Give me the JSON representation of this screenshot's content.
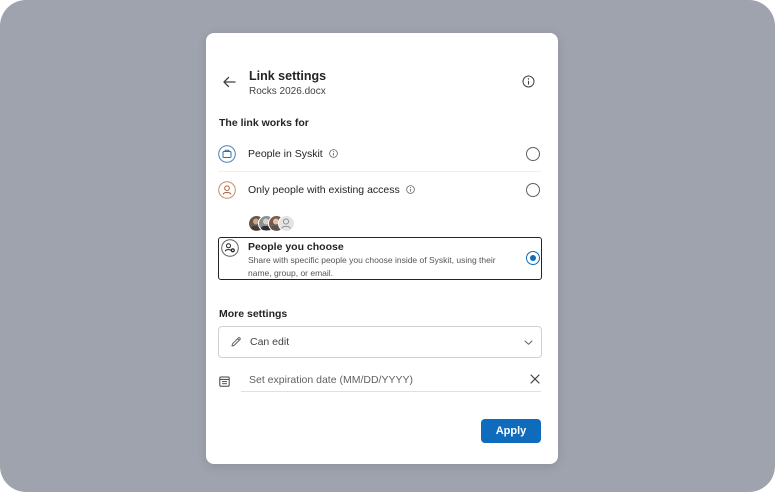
{
  "dialog": {
    "title": "Link settings",
    "file_name": "Rocks 2026.docx"
  },
  "link_works_for": {
    "label": "The link works for",
    "options": [
      {
        "label": "People in Syskit",
        "icon": "organization-icon",
        "selected": false
      },
      {
        "label": "Only people with existing access",
        "icon": "person-icon",
        "selected": false
      },
      {
        "label": "People you choose",
        "description": "Share with specific people you choose inside of Syskit, using their name, group, or email.",
        "icon": "people-settings-icon",
        "selected": true
      }
    ]
  },
  "more_settings": {
    "label": "More settings",
    "permission": {
      "value": "Can edit",
      "icon": "pencil-icon"
    },
    "expiration": {
      "placeholder": "Set expiration date (MM/DD/YYYY)",
      "icon": "calendar-icon"
    }
  },
  "footer": {
    "apply_label": "Apply"
  },
  "colors": {
    "accent": "#0f6cbd",
    "backdrop": "#9ea3ae"
  }
}
